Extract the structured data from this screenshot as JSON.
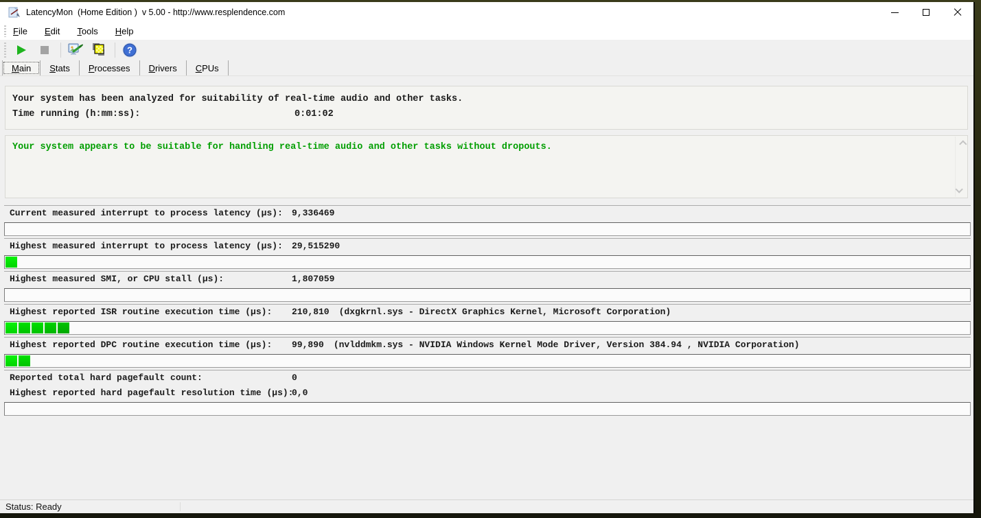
{
  "window": {
    "title": "LatencyMon  (Home Edition )  v 5.00 - http://www.resplendence.com",
    "controls": [
      "minimize-button",
      "maximize-button",
      "close-button"
    ]
  },
  "menu_bar": {
    "items": [
      "File",
      "Edit",
      "Tools",
      "Help"
    ]
  },
  "toolbar": {
    "icons": [
      "start-monitor-icon",
      "stop-monitor-icon",
      "options-icon",
      "report-icon",
      "help-icon"
    ]
  },
  "tab_bar": {
    "tabs": [
      "Main",
      "Stats",
      "Processes",
      "Drivers",
      "CPUs"
    ],
    "selected": "Main"
  },
  "summary_panel": {
    "line1": "Your system has been analyzed for suitability of real-time audio and other tasks.",
    "time_label": "Time running (h:mm:ss):",
    "time_value": "0:01:02"
  },
  "verdict_panel": {
    "message": "Your system appears to be suitable for handling real-time audio and other tasks without dropouts.",
    "text_color": "#009e00"
  },
  "metrics": [
    {
      "label": "Current measured interrupt to process latency (µs):",
      "value": "9,336469",
      "detail": "",
      "segments": 0,
      "has_bar": true
    },
    {
      "label": "Highest measured interrupt to process latency (µs):",
      "value": "29,515290",
      "detail": "",
      "segments": 1,
      "has_bar": true
    },
    {
      "label": "Highest measured SMI, or CPU stall (µs):",
      "value": "1,807059",
      "detail": "",
      "segments": 0,
      "has_bar": true
    },
    {
      "label": "Highest reported ISR routine execution time (µs):",
      "value": "210,810",
      "detail": "(dxgkrnl.sys - DirectX Graphics Kernel, Microsoft Corporation)",
      "segments": 5,
      "has_bar": true
    },
    {
      "label": "Highest reported DPC routine execution time (µs):",
      "value": "99,890",
      "detail": "(nvlddmkm.sys - NVIDIA Windows Kernel Mode Driver, Version 384.94 , NVIDIA Corporation)",
      "segments": 2,
      "has_bar": true
    },
    {
      "label": "Reported total hard pagefault count:",
      "value": "0",
      "detail": "",
      "segments": 0,
      "has_bar": false
    },
    {
      "label": "Highest reported hard pagefault resolution time (µs):",
      "value": "0,0",
      "detail": "",
      "segments": 0,
      "has_bar": true
    }
  ],
  "status_bar": {
    "text": "Status: Ready"
  },
  "colors": {
    "bar_green": "#00d400",
    "verdict_green": "#009e00",
    "window_bg": "#f0f0f0",
    "titlebar_bg": "#ffffff"
  }
}
